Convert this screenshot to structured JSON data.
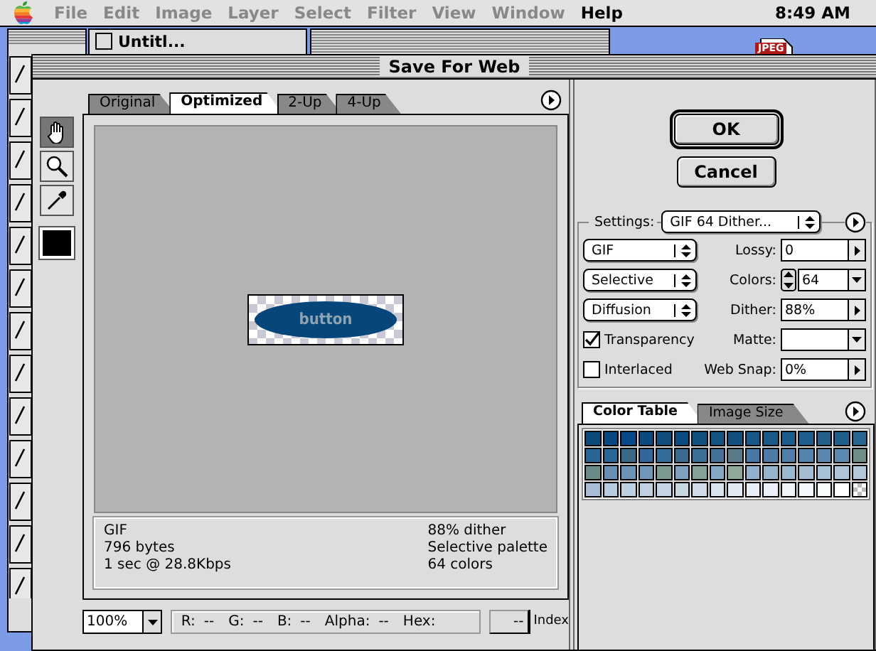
{
  "menu_bar": {
    "items": [
      {
        "label": "File",
        "disabled": true
      },
      {
        "label": "Edit",
        "disabled": true
      },
      {
        "label": "Image",
        "disabled": true
      },
      {
        "label": "Layer",
        "disabled": true
      },
      {
        "label": "Select",
        "disabled": true
      },
      {
        "label": "Filter",
        "disabled": true
      },
      {
        "label": "View",
        "disabled": true
      },
      {
        "label": "Window",
        "disabled": true
      },
      {
        "label": "Help",
        "disabled": false
      }
    ],
    "clock": "8:49 AM"
  },
  "document_window": {
    "title": "Untitl..."
  },
  "desktop_icon": {
    "label": "JPEG"
  },
  "dialog": {
    "title": "Save For Web",
    "tools": [
      {
        "kind": "hand",
        "selected": true
      },
      {
        "kind": "zoom",
        "selected": false
      },
      {
        "kind": "eyedropper",
        "selected": false
      }
    ],
    "view_tabs": [
      {
        "label": "Original",
        "selected": false
      },
      {
        "label": "Optimized",
        "selected": true
      },
      {
        "label": "2-Up",
        "selected": false
      },
      {
        "label": "4-Up",
        "selected": false
      }
    ],
    "preview": {
      "image_text": "button"
    },
    "info_left": [
      "GIF",
      "796 bytes",
      "1 sec @ 28.8Kbps"
    ],
    "info_right": [
      "88% dither",
      "Selective palette",
      "64 colors"
    ],
    "zoom": "100%",
    "readouts": [
      {
        "label": "R:",
        "value": "--"
      },
      {
        "label": "G:",
        "value": "--"
      },
      {
        "label": "B:",
        "value": "--"
      },
      {
        "label": "Alpha:",
        "value": "--"
      }
    ],
    "hex_label": "Hex:",
    "hex_value": "--",
    "index_label": "Index",
    "buttons": [
      {
        "label": "OK",
        "default": true
      },
      {
        "label": "Cancel",
        "default": false
      }
    ],
    "settings": {
      "label": "Settings:",
      "preset": "GIF 64 Dither...",
      "menus": [
        "GIF",
        "Selective",
        "Diffusion"
      ],
      "checkboxes": [
        {
          "label": "Transparency",
          "checked": true
        },
        {
          "label": "Interlaced",
          "checked": false
        }
      ],
      "fields": [
        {
          "label": "Lossy:",
          "value": "0",
          "kind": "slider"
        },
        {
          "label": "Colors:",
          "value": "64",
          "kind": "stepper"
        },
        {
          "label": "Dither:",
          "value": "88%",
          "kind": "slider"
        },
        {
          "label": "Matte:",
          "kind": "menu"
        },
        {
          "label": "Web Snap:",
          "value": "0%",
          "kind": "slider"
        }
      ]
    },
    "panel_tabs": [
      {
        "label": "Color Table",
        "selected": true
      },
      {
        "label": "Image Size",
        "selected": false
      }
    ],
    "color_table": {
      "transparent_entry": true,
      "rows": [
        {
          "swatches": [
            {
              "color": "#0a4a7a"
            },
            {
              "color": "#084880"
            },
            {
              "color": "#064888"
            },
            {
              "color": "#0a4a80"
            },
            {
              "color": "#104c7c"
            },
            {
              "color": "#0c4c80"
            },
            {
              "color": "#0e5080"
            },
            {
              "color": "#145480"
            },
            {
              "color": "#12507e"
            },
            {
              "color": "#185888"
            },
            {
              "color": "#1a5a88"
            },
            {
              "color": "#1c5c8c"
            },
            {
              "color": "#1e5e8a"
            },
            {
              "color": "#245f8a"
            },
            {
              "color": "#205e8c"
            },
            {
              "color": "#2a6690"
            }
          ]
        },
        {
          "swatches": [
            {
              "color": "#2a6494"
            },
            {
              "color": "#2c6698"
            },
            {
              "color": "#386a88"
            },
            {
              "color": "#30689a"
            },
            {
              "color": "#346c98"
            },
            {
              "color": "#3a6c90"
            },
            {
              "color": "#3c7096"
            },
            {
              "color": "#44709a"
            },
            {
              "color": "#5c7a8a"
            },
            {
              "color": "#4878a4"
            },
            {
              "color": "#4c7ca6"
            },
            {
              "color": "#5080a8"
            },
            {
              "color": "#5484ac"
            },
            {
              "color": "#5a88ae"
            },
            {
              "color": "#5c8aae"
            },
            {
              "color": "#6e8c88"
            }
          ]
        },
        {
          "swatches": [
            {
              "color": "#6a8a88"
            },
            {
              "color": "#6890b4"
            },
            {
              "color": "#6c94b8"
            },
            {
              "color": "#7096ba"
            },
            {
              "color": "#7a9a90"
            },
            {
              "color": "#7ea0bc"
            },
            {
              "color": "#84a098"
            },
            {
              "color": "#84a8c4"
            },
            {
              "color": "#90a898"
            },
            {
              "color": "#90b0cc"
            },
            {
              "color": "#98b4cc"
            },
            {
              "color": "#9cb8d0"
            },
            {
              "color": "#a4bcd2"
            },
            {
              "color": "#a8c0d4"
            },
            {
              "color": "#b0c4d8"
            },
            {
              "color": "#b4c8dc"
            }
          ]
        },
        {
          "swatches": [
            {
              "color": "#a8bcd8"
            },
            {
              "color": "#b8cce0"
            },
            {
              "color": "#bcd0e0"
            },
            {
              "color": "#c0d0e0"
            },
            {
              "color": "#c4d4e4"
            },
            {
              "color": "#c8d8e0"
            },
            {
              "color": "#d0dcea"
            },
            {
              "color": "#d8e4ee"
            },
            {
              "color": "#e0eaf0"
            },
            {
              "color": "#e8eef6"
            },
            {
              "color": "#eaf0f8"
            },
            {
              "color": "#f0f4f8"
            },
            {
              "color": "#f4f8fc"
            },
            {
              "color": "#f8fcfc"
            },
            {
              "color": "#ffffff"
            }
          ]
        }
      ]
    }
  }
}
